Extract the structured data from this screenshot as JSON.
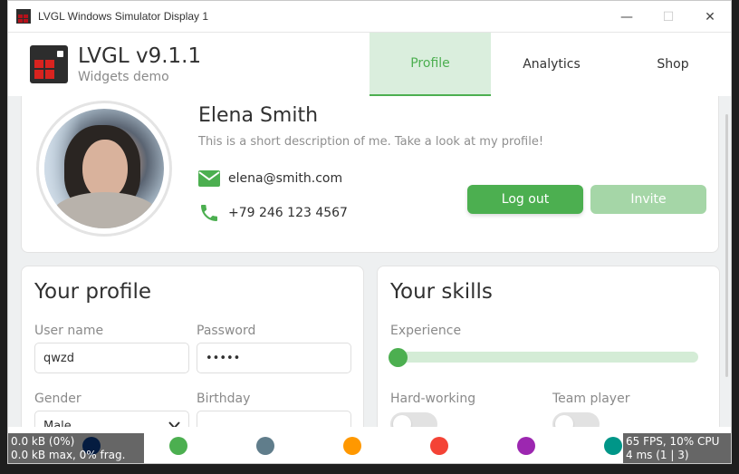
{
  "window": {
    "title": "LVGL Windows Simulator Display 1",
    "minimize_glyph": "—",
    "maximize_glyph": "☐",
    "close_glyph": "✕"
  },
  "header": {
    "title": "LVGL v9.1.1",
    "subtitle": "Widgets demo",
    "tabs": [
      {
        "label": "Profile",
        "active": true
      },
      {
        "label": "Analytics",
        "active": false
      },
      {
        "label": "Shop",
        "active": false
      }
    ]
  },
  "profile": {
    "name": "Elena Smith",
    "description": "This is a short description of me. Take a look at my profile!",
    "email": "elena@smith.com",
    "phone": "+79 246 123 4567",
    "logout_label": "Log out",
    "invite_label": "Invite"
  },
  "your_profile": {
    "title": "Your profile",
    "username_label": "User name",
    "username_value": "qwzd",
    "password_label": "Password",
    "password_value": "•••••",
    "gender_label": "Gender",
    "gender_value": "Male",
    "birthday_label": "Birthday",
    "birthday_value": ""
  },
  "your_skills": {
    "title": "Your skills",
    "experience_label": "Experience",
    "experience_level": 0,
    "hard_working_label": "Hard-working",
    "hard_working_on": false,
    "team_player_label": "Team player",
    "team_player_on": false
  },
  "overlays": {
    "mem_line1": "0.0 kB (0%)",
    "mem_line2": "0.0 kB max, 0% frag.",
    "perf_line1": "65 FPS, 10% CPU",
    "perf_line2": "4 ms (1 | 3)"
  },
  "colors": {
    "accent": "#4caf50",
    "accent_light": "#a5d6a7",
    "tab_active_bg": "#daeedd",
    "palette": [
      "#0d47a1",
      "#4caf50",
      "#607d8b",
      "#ff9800",
      "#f44336",
      "#9c27b0",
      "#009688"
    ]
  }
}
